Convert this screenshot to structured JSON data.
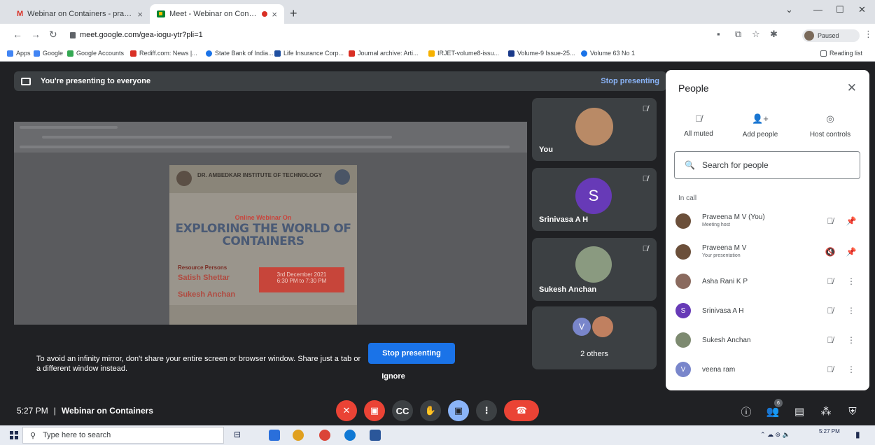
{
  "browser": {
    "tabs": [
      {
        "title": "Webinar on Containers - pravee",
        "favicon": "gmail-icon"
      },
      {
        "title": "Meet - Webinar on Contain",
        "favicon": "meet-icon"
      }
    ],
    "url": "meet.google.com/gea-iogu-ytr?pli=1",
    "profile_status": "Paused",
    "bookmarks": [
      {
        "label": "Apps",
        "color": "#4285f4"
      },
      {
        "label": "Google",
        "color": "#4285f4"
      },
      {
        "label": "Google Accounts",
        "color": "#34a853"
      },
      {
        "label": "Rediff.com: News |...",
        "color": "#d93025"
      },
      {
        "label": "State Bank of India...",
        "color": "#1a73e8"
      },
      {
        "label": "Life Insurance Corp...",
        "color": "#1f4fa0"
      },
      {
        "label": "Journal archive: Arti...",
        "color": "#d93025"
      },
      {
        "label": "IRJET-volume8-issu...",
        "color": "#f6b100"
      },
      {
        "label": "Volume-9 Issue-25...",
        "color": "#1a3a8a"
      },
      {
        "label": "Volume 63 No 1",
        "color": "#1a73e8"
      }
    ],
    "reading_list": "Reading list"
  },
  "meet": {
    "presenting_banner": "You're presenting to everyone",
    "stop_presenting_link": "Stop presenting",
    "poster": {
      "institute": "DR. AMBEDKAR INSTITUTE OF TECHNOLOGY",
      "subtitle": "Online Webinar On",
      "title_line1": "EXPLORING THE WORLD OF",
      "title_line2": "CONTAINERS",
      "resource_label": "Resource Persons",
      "speaker1": "Satish Shettar",
      "speaker2": "Sukesh Anchan",
      "date": "3rd December 2021",
      "time": "6:30 PM to 7:30 PM"
    },
    "mirror_warning": "To avoid an infinity mirror, don't share your entire screen or browser window. Share just a tab or a different window instead.",
    "stop_button": "Stop presenting",
    "ignore_button": "Ignore",
    "tiles": [
      {
        "name": "You"
      },
      {
        "name": "Srinivasa A H",
        "initial": "S"
      },
      {
        "name": "Sukesh Anchan"
      },
      {
        "name": "2 others",
        "initial": "V"
      }
    ],
    "time": "5:27 PM",
    "meeting_name": "Webinar on Containers",
    "participant_count": "6"
  },
  "people_panel": {
    "title": "People",
    "actions": [
      {
        "label": "All muted",
        "icon": "mic-off-icon"
      },
      {
        "label": "Add people",
        "icon": "add-person-icon"
      },
      {
        "label": "Host controls",
        "icon": "toggle-icon"
      }
    ],
    "search_placeholder": "Search for people",
    "in_call_label": "In call",
    "participants": [
      {
        "name": "Praveena M V (You)",
        "sub": "Meeting host",
        "avatar_color": "#6b4f3a"
      },
      {
        "name": "Praveena M V",
        "sub": "Your presentation",
        "avatar_color": "#6b4f3a"
      },
      {
        "name": "Asha Rani K P",
        "sub": "",
        "avatar_color": "#8a6a5e"
      },
      {
        "name": "Srinivasa A H",
        "sub": "",
        "avatar_color": "#673ab7",
        "initial": "S"
      },
      {
        "name": "Sukesh Anchan",
        "sub": "",
        "avatar_color": "#7d8a70"
      },
      {
        "name": "veena ram",
        "sub": "",
        "avatar_color": "#7986cb",
        "initial": "V"
      }
    ]
  },
  "taskbar": {
    "search_placeholder": "Type here to search",
    "clock": "5:27 PM"
  }
}
